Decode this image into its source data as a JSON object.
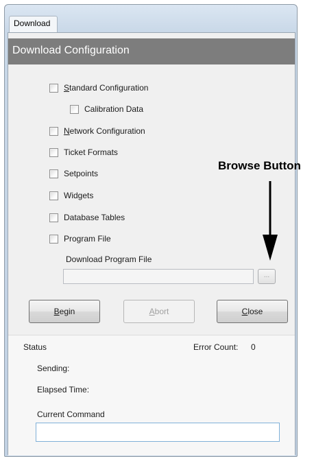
{
  "window": {
    "title": "Download"
  },
  "header": {
    "title": "Download Configuration"
  },
  "options": [
    {
      "prefix": "",
      "accel": "S",
      "rest": "tandard Configuration"
    },
    {
      "prefix": "",
      "accel": "",
      "rest": "Calibration Data"
    },
    {
      "prefix": "",
      "accel": "N",
      "rest": "etwork Configuration"
    },
    {
      "prefix": "",
      "accel": "",
      "rest": "Ticket Formats"
    },
    {
      "prefix": "",
      "accel": "",
      "rest": "Setpoints"
    },
    {
      "prefix": "",
      "accel": "",
      "rest": "Widgets"
    },
    {
      "prefix": "",
      "accel": "",
      "rest": "Database Tables"
    },
    {
      "prefix": "",
      "accel": "",
      "rest": "Program File"
    }
  ],
  "program_file": {
    "label": "Download Program File",
    "value": "",
    "browse_label": "..."
  },
  "buttons": {
    "begin": {
      "accel": "B",
      "rest": "egin"
    },
    "abort": {
      "accel": "A",
      "rest": "bort"
    },
    "close": {
      "accel": "C",
      "rest": "lose"
    }
  },
  "status": {
    "title": "Status",
    "error_count_label": "Error Count:",
    "error_count_value": "0",
    "sending_label": "Sending:",
    "elapsed_label": "Elapsed Time:",
    "current_command_label": "Current Command",
    "current_command_value": ""
  },
  "annotation": {
    "text": "Browse Button"
  }
}
